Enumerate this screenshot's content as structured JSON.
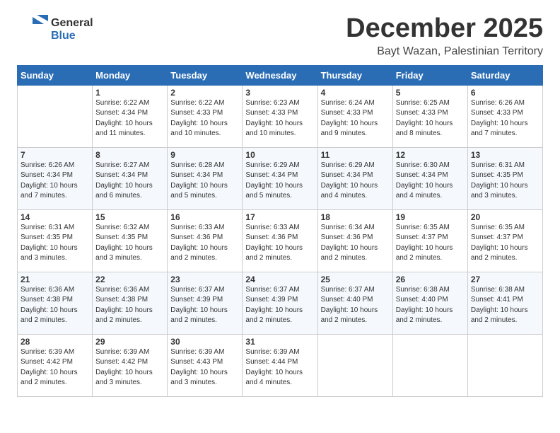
{
  "logo": {
    "general": "General",
    "blue": "Blue"
  },
  "header": {
    "month": "December 2025",
    "location": "Bayt Wazan, Palestinian Territory"
  },
  "days_of_week": [
    "Sunday",
    "Monday",
    "Tuesday",
    "Wednesday",
    "Thursday",
    "Friday",
    "Saturday"
  ],
  "weeks": [
    [
      {
        "day": "",
        "info": ""
      },
      {
        "day": "1",
        "info": "Sunrise: 6:22 AM\nSunset: 4:34 PM\nDaylight: 10 hours\nand 11 minutes."
      },
      {
        "day": "2",
        "info": "Sunrise: 6:22 AM\nSunset: 4:33 PM\nDaylight: 10 hours\nand 10 minutes."
      },
      {
        "day": "3",
        "info": "Sunrise: 6:23 AM\nSunset: 4:33 PM\nDaylight: 10 hours\nand 10 minutes."
      },
      {
        "day": "4",
        "info": "Sunrise: 6:24 AM\nSunset: 4:33 PM\nDaylight: 10 hours\nand 9 minutes."
      },
      {
        "day": "5",
        "info": "Sunrise: 6:25 AM\nSunset: 4:33 PM\nDaylight: 10 hours\nand 8 minutes."
      },
      {
        "day": "6",
        "info": "Sunrise: 6:26 AM\nSunset: 4:33 PM\nDaylight: 10 hours\nand 7 minutes."
      }
    ],
    [
      {
        "day": "7",
        "info": "Sunrise: 6:26 AM\nSunset: 4:34 PM\nDaylight: 10 hours\nand 7 minutes."
      },
      {
        "day": "8",
        "info": "Sunrise: 6:27 AM\nSunset: 4:34 PM\nDaylight: 10 hours\nand 6 minutes."
      },
      {
        "day": "9",
        "info": "Sunrise: 6:28 AM\nSunset: 4:34 PM\nDaylight: 10 hours\nand 5 minutes."
      },
      {
        "day": "10",
        "info": "Sunrise: 6:29 AM\nSunset: 4:34 PM\nDaylight: 10 hours\nand 5 minutes."
      },
      {
        "day": "11",
        "info": "Sunrise: 6:29 AM\nSunset: 4:34 PM\nDaylight: 10 hours\nand 4 minutes."
      },
      {
        "day": "12",
        "info": "Sunrise: 6:30 AM\nSunset: 4:34 PM\nDaylight: 10 hours\nand 4 minutes."
      },
      {
        "day": "13",
        "info": "Sunrise: 6:31 AM\nSunset: 4:35 PM\nDaylight: 10 hours\nand 3 minutes."
      }
    ],
    [
      {
        "day": "14",
        "info": "Sunrise: 6:31 AM\nSunset: 4:35 PM\nDaylight: 10 hours\nand 3 minutes."
      },
      {
        "day": "15",
        "info": "Sunrise: 6:32 AM\nSunset: 4:35 PM\nDaylight: 10 hours\nand 3 minutes."
      },
      {
        "day": "16",
        "info": "Sunrise: 6:33 AM\nSunset: 4:36 PM\nDaylight: 10 hours\nand 2 minutes."
      },
      {
        "day": "17",
        "info": "Sunrise: 6:33 AM\nSunset: 4:36 PM\nDaylight: 10 hours\nand 2 minutes."
      },
      {
        "day": "18",
        "info": "Sunrise: 6:34 AM\nSunset: 4:36 PM\nDaylight: 10 hours\nand 2 minutes."
      },
      {
        "day": "19",
        "info": "Sunrise: 6:35 AM\nSunset: 4:37 PM\nDaylight: 10 hours\nand 2 minutes."
      },
      {
        "day": "20",
        "info": "Sunrise: 6:35 AM\nSunset: 4:37 PM\nDaylight: 10 hours\nand 2 minutes."
      }
    ],
    [
      {
        "day": "21",
        "info": "Sunrise: 6:36 AM\nSunset: 4:38 PM\nDaylight: 10 hours\nand 2 minutes."
      },
      {
        "day": "22",
        "info": "Sunrise: 6:36 AM\nSunset: 4:38 PM\nDaylight: 10 hours\nand 2 minutes."
      },
      {
        "day": "23",
        "info": "Sunrise: 6:37 AM\nSunset: 4:39 PM\nDaylight: 10 hours\nand 2 minutes."
      },
      {
        "day": "24",
        "info": "Sunrise: 6:37 AM\nSunset: 4:39 PM\nDaylight: 10 hours\nand 2 minutes."
      },
      {
        "day": "25",
        "info": "Sunrise: 6:37 AM\nSunset: 4:40 PM\nDaylight: 10 hours\nand 2 minutes."
      },
      {
        "day": "26",
        "info": "Sunrise: 6:38 AM\nSunset: 4:40 PM\nDaylight: 10 hours\nand 2 minutes."
      },
      {
        "day": "27",
        "info": "Sunrise: 6:38 AM\nSunset: 4:41 PM\nDaylight: 10 hours\nand 2 minutes."
      }
    ],
    [
      {
        "day": "28",
        "info": "Sunrise: 6:39 AM\nSunset: 4:42 PM\nDaylight: 10 hours\nand 2 minutes."
      },
      {
        "day": "29",
        "info": "Sunrise: 6:39 AM\nSunset: 4:42 PM\nDaylight: 10 hours\nand 3 minutes."
      },
      {
        "day": "30",
        "info": "Sunrise: 6:39 AM\nSunset: 4:43 PM\nDaylight: 10 hours\nand 3 minutes."
      },
      {
        "day": "31",
        "info": "Sunrise: 6:39 AM\nSunset: 4:44 PM\nDaylight: 10 hours\nand 4 minutes."
      },
      {
        "day": "",
        "info": ""
      },
      {
        "day": "",
        "info": ""
      },
      {
        "day": "",
        "info": ""
      }
    ]
  ]
}
